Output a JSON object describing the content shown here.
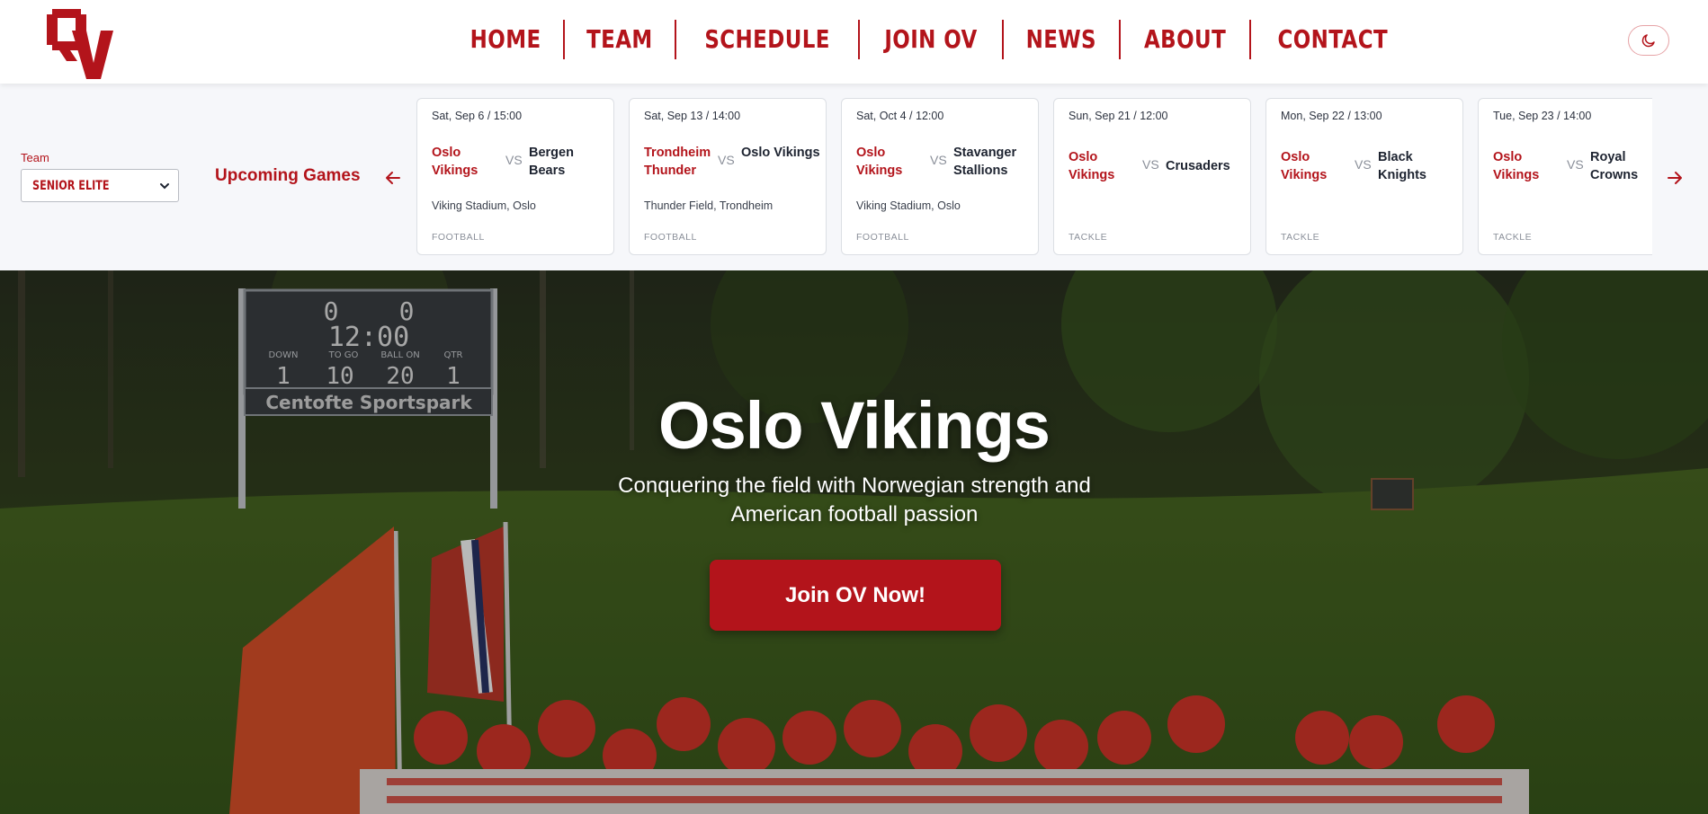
{
  "brand": {
    "logo_text": "OV",
    "accent": "#b3141b"
  },
  "nav": {
    "items": [
      {
        "label": "HOME"
      },
      {
        "label": "TEAM"
      },
      {
        "label": "SCHEDULE"
      },
      {
        "label": "JOIN OV"
      },
      {
        "label": "NEWS"
      },
      {
        "label": "ABOUT"
      },
      {
        "label": "CONTACT"
      }
    ],
    "theme_toggle_icon": "moon-icon"
  },
  "games": {
    "team_label": "Team",
    "team_selected": "SENIOR ELITE",
    "title": "Upcoming Games",
    "vs_label": "VS",
    "cards": [
      {
        "date": "Sat, Sep 6 / 15:00",
        "home": "Oslo Vikings",
        "away": "Bergen Bears",
        "venue": "Viking Stadium, Oslo",
        "type": "FOOTBALL"
      },
      {
        "date": "Sat, Sep 13 / 14:00",
        "home": "Trondheim Thunder",
        "away": "Oslo Vikings",
        "venue": "Thunder Field, Trondheim",
        "type": "FOOTBALL"
      },
      {
        "date": "Sat, Oct 4 / 12:00",
        "home": "Oslo Vikings",
        "away": "Stavanger Stallions",
        "venue": "Viking Stadium, Oslo",
        "type": "FOOTBALL"
      },
      {
        "date": "Sun, Sep 21 / 12:00",
        "home": "Oslo Vikings",
        "away": "Crusaders",
        "venue": "",
        "type": "TACKLE"
      },
      {
        "date": "Mon, Sep 22 / 13:00",
        "home": "Oslo Vikings",
        "away": "Black Knights",
        "venue": "",
        "type": "TACKLE"
      },
      {
        "date": "Tue, Sep 23 / 14:00",
        "home": "Oslo Vikings",
        "away": "Royal Crowns",
        "venue": "",
        "type": "TACKLE"
      }
    ]
  },
  "hero": {
    "title": "Oslo Vikings",
    "subtitle": "Conquering the field with Norwegian strength and American football passion",
    "cta": "Join OV Now!",
    "scoreboard": {
      "home_score": "0",
      "away_score": "0",
      "clock": "12:00",
      "headers": [
        "DOWN",
        "TO GO",
        "BALL ON",
        "QTR"
      ],
      "values": [
        "1",
        "10",
        "20",
        "1"
      ],
      "venue_name": "Centofte Sportspark"
    }
  }
}
